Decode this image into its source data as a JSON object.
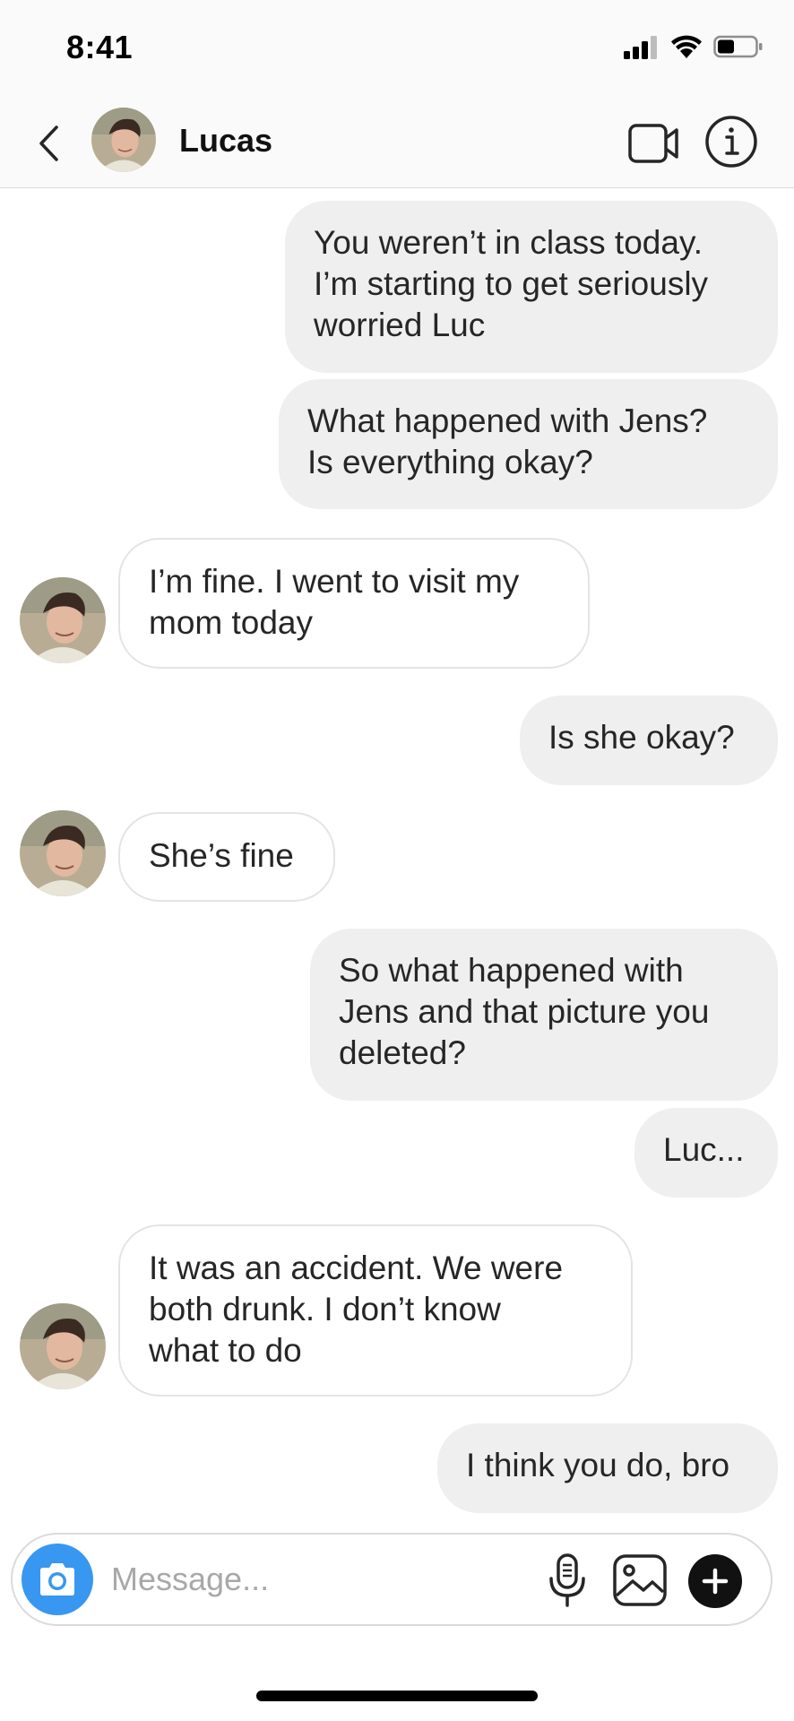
{
  "status_bar": {
    "time": "8:41",
    "icons": [
      "cellular-signal-icon",
      "wifi-icon",
      "battery-icon"
    ]
  },
  "header": {
    "back_icon": "chevron-left-icon",
    "contact_name": "Lucas",
    "actions": [
      "video-call-icon",
      "info-icon"
    ]
  },
  "messages": [
    {
      "direction": "sent",
      "text": "You weren’t in class today.\nI’m starting to get seriously\nworried Luc"
    },
    {
      "direction": "sent",
      "text": "What happened with Jens?\nIs everything okay?"
    },
    {
      "direction": "received",
      "text": "I’m fine. I went to visit my\nmom today"
    },
    {
      "direction": "sent",
      "text": "Is she okay?"
    },
    {
      "direction": "received",
      "text": "She’s fine"
    },
    {
      "direction": "sent",
      "text": "So what happened with\nJens and that picture you\ndeleted?"
    },
    {
      "direction": "sent",
      "text": "Luc..."
    },
    {
      "direction": "received",
      "text": "It was an accident. We were\nboth drunk. I don’t know\nwhat to do"
    },
    {
      "direction": "sent",
      "text": "I think you do, bro"
    }
  ],
  "composer": {
    "placeholder": "Message...",
    "value": "",
    "icons": [
      "camera-icon",
      "microphone-icon",
      "gallery-icon",
      "plus-icon"
    ]
  },
  "colors": {
    "sent_bubble": "#efefef",
    "received_border": "#e4e4e4",
    "camera_blue": "#3897f0",
    "text": "#262626",
    "placeholder": "#a8a8a8"
  }
}
